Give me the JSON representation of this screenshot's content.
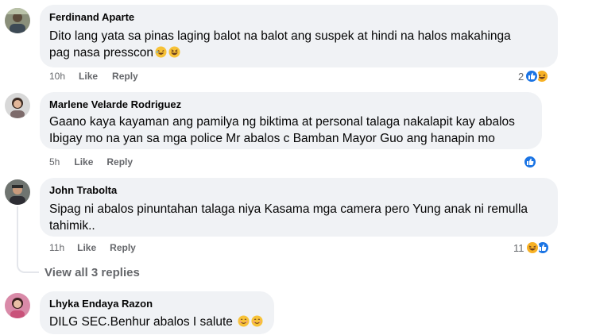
{
  "colors": {
    "bubble": "#f0f2f5",
    "secondary_text": "#65676b",
    "like_blue": "#1b74e4",
    "haha_yellow": "#f7b125"
  },
  "comments": [
    {
      "author": "Ferdinand Aparte",
      "lines": [
        "Dito lang yata sa pinas laging balot na balot ang suspek at hindi na halos makahinga",
        "pag nasa presscon"
      ],
      "inline_emoji": [
        "rolling-on-floor-laughing-emoji",
        "grinning-squinting-emoji"
      ],
      "time": "10h",
      "like_label": "Like",
      "reply_label": "Reply",
      "reaction_count": "2",
      "reaction_icons": [
        "like-icon",
        "haha-icon"
      ]
    },
    {
      "author": "Marlene Velarde Rodriguez",
      "lines": [
        "Gaano kaya kayaman ang pamilya ng biktima at personal talaga nakalapit kay abalos",
        "Ibigay mo na yan sa mga police Mr abalos c Bamban Mayor Guo ang hanapin mo"
      ],
      "time": "5h",
      "like_label": "Like",
      "reply_label": "Reply",
      "reaction_count": "",
      "reaction_icons": [
        "like-icon"
      ]
    },
    {
      "author": "John Trabolta",
      "lines": [
        "Sipag ni abalos pinuntahan talaga niya Kasama mga camera pero Yung anak ni remulla",
        "tahimik.."
      ],
      "time": "11h",
      "like_label": "Like",
      "reply_label": "Reply",
      "reaction_count": "11",
      "reaction_icons": [
        "haha-icon",
        "like-icon"
      ]
    },
    {
      "author": "Lhyka Endaya Razon",
      "lines": [
        "DILG SEC.Benhur abalos I salute "
      ],
      "inline_emoji": [
        "smiling-face-emoji",
        "smiling-face-emoji"
      ]
    }
  ],
  "view_replies": "View all 3 replies"
}
